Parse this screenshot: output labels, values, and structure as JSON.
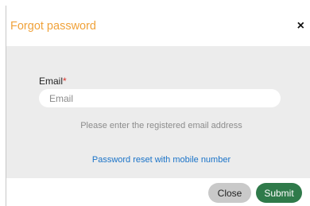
{
  "dialog": {
    "title": "Forgot password",
    "close_icon": "close-icon",
    "close_glyph": "×"
  },
  "form": {
    "email_label": "Email",
    "required_marker": "*",
    "email_placeholder": "Email",
    "email_value": "",
    "hint": "Please enter the registered email address",
    "mobile_reset_link": "Password reset with mobile number"
  },
  "footer": {
    "close_label": "Close",
    "submit_label": "Submit"
  },
  "colors": {
    "title": "#f0a23a",
    "link": "#1a73c8",
    "submit": "#2f7a4a",
    "required": "#d9342b"
  }
}
